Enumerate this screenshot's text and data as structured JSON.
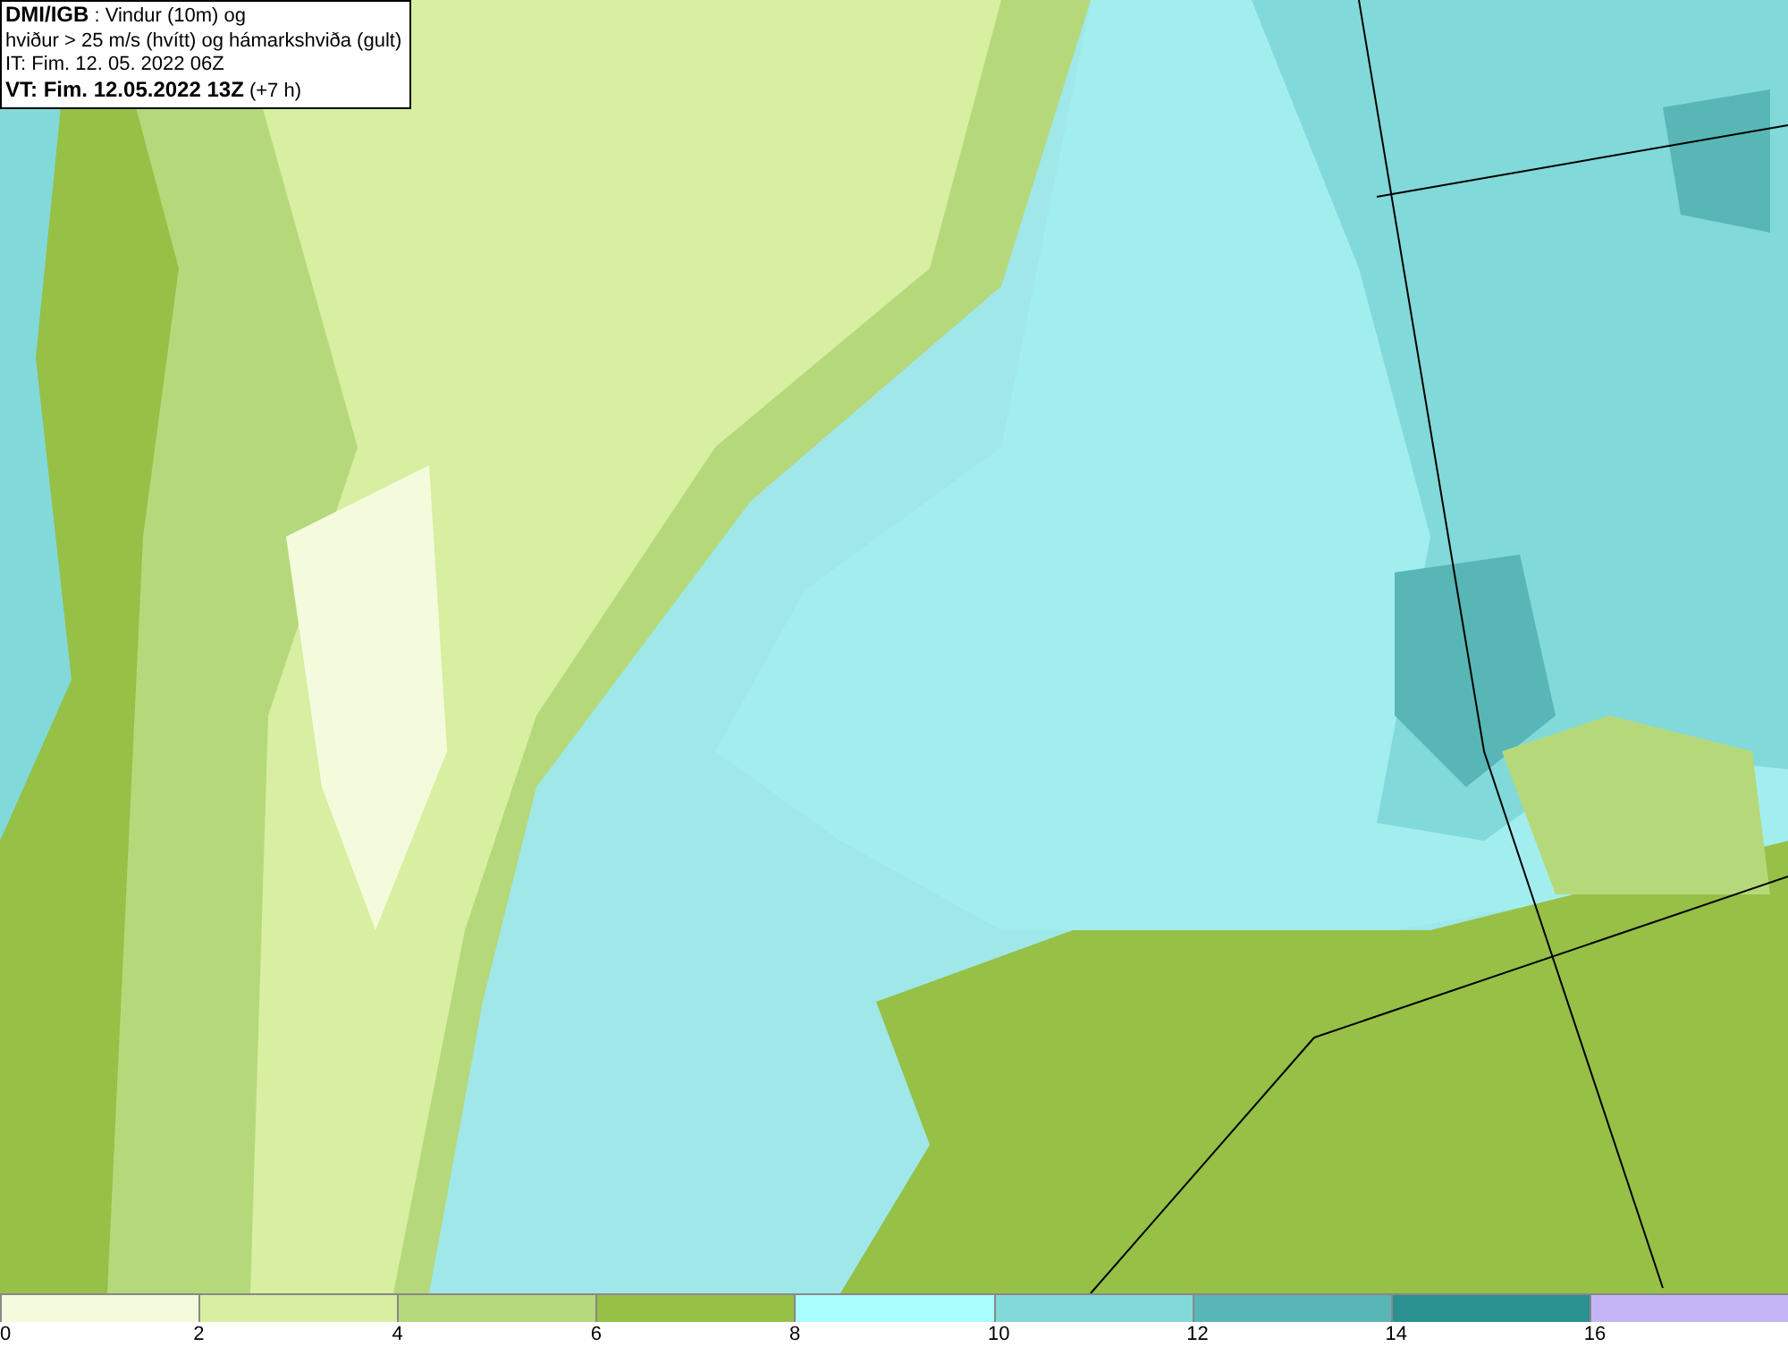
{
  "title_box": {
    "lines": [
      "**DMI/IGB** : Vindur (10m) og",
      "hviður > 25 m/s (hvítt) og hámarkshviða (gult)",
      "IT: Fim. 12. 05. 2022 06Z",
      "**VT: Fim. 12.05.2022 13Z** (+7 h)"
    ]
  },
  "legend": [
    {
      "label": "0",
      "color": "#f4fbdc"
    },
    {
      "label": "2",
      "color": "#d8eea0"
    },
    {
      "label": "4",
      "color": "#b5d97a"
    },
    {
      "label": "6",
      "color": "#96c046"
    },
    {
      "label": "8",
      "color": "#a9fdfd"
    },
    {
      "label": "10",
      "color": "#82d9d9"
    },
    {
      "label": "12",
      "color": "#58b6b6"
    },
    {
      "label": "14",
      "color": "#2a9090"
    },
    {
      "label": "16",
      "color": "#c4b4f5"
    }
  ]
}
